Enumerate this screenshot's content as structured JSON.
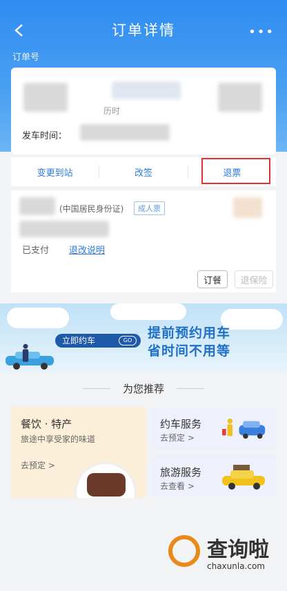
{
  "header": {
    "title": "订单详情",
    "more": "•••",
    "order_label": "订单号"
  },
  "ticket": {
    "via": "历时",
    "depart_label": "发车时间："
  },
  "actions": {
    "change_station": "变更到站",
    "rebook": "改签",
    "refund": "退票"
  },
  "passenger": {
    "id_type": "(中国居民身份证)",
    "ticket_type": "成人票",
    "status": "已支付",
    "refund_rules": "退改说明",
    "meal_button": "订餐",
    "insurance_button": "退保险"
  },
  "banner": {
    "book_car": "立即约车",
    "go": "GO",
    "slogan_line1": "提前预约用车",
    "slogan_line2": "省时间不用等"
  },
  "recommend": {
    "title": "为您推荐",
    "food": {
      "title": "餐饮 · 特产",
      "subtitle": "旅途中享受家的味道",
      "link": "去预定 >"
    },
    "car": {
      "title": "约车服务",
      "link": "去预定 >"
    },
    "travel": {
      "title": "旅游服务",
      "link": "去查看 >"
    }
  },
  "watermark": {
    "text": "查询啦",
    "url": "chaxunla.com"
  },
  "colors": {
    "primary": "#2f8cf0",
    "link": "#2e7bd8",
    "highlight_box": "#e03030"
  }
}
